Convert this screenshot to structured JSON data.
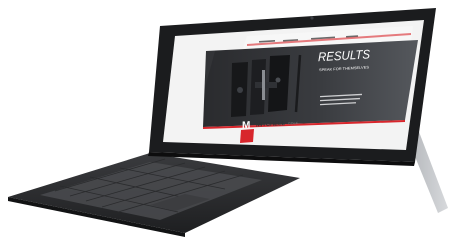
{
  "website": {
    "nav_items": [
      "",
      "",
      "",
      ""
    ],
    "hero_heading": "RESULTS",
    "hero_subheading": "SPEAK FOR THEMSELVES",
    "brand_name": "MITCHELL",
    "brand_suffix": "GOLF",
    "accent_color": "#d8262c",
    "logo_letter": "M"
  },
  "device": {
    "type": "tablet-with-keyboard-cover",
    "frame_color": "#1b1c1e",
    "keyboard_color": "#2a2b2d",
    "kickstand_color": "#b9bcc0",
    "camera_icon": "camera-icon"
  }
}
